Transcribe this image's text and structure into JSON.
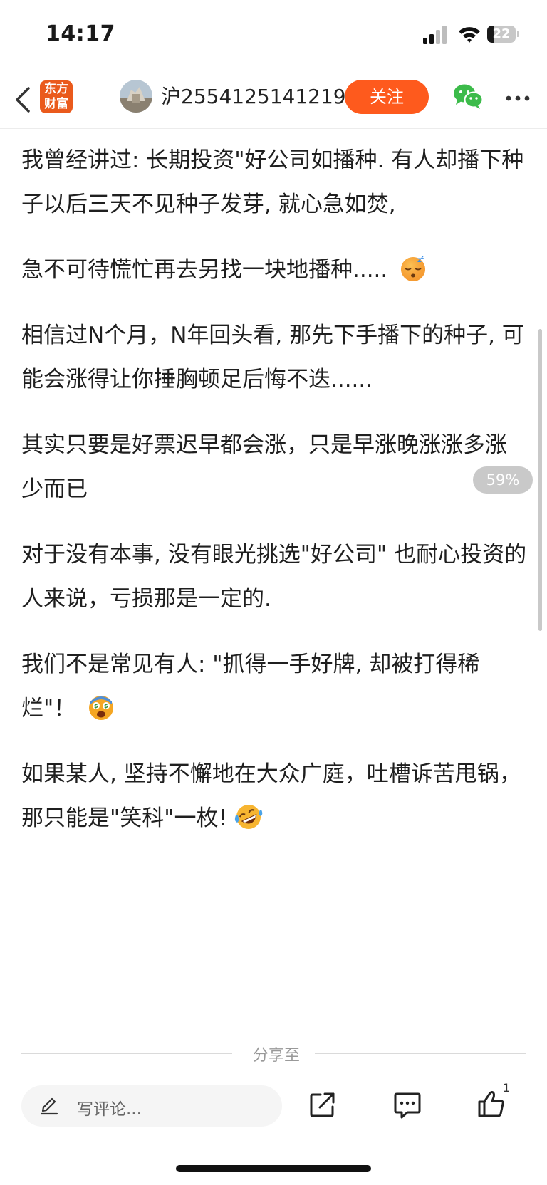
{
  "status_bar": {
    "time": "14:17",
    "battery_level": "22"
  },
  "nav": {
    "logo_line1": "东方",
    "logo_line2": "财富",
    "username": "沪2554125141219",
    "follow_label": "关注"
  },
  "article": {
    "paragraphs": [
      "我曾经讲过: 长期投资\"好公司如播种. 有人却播下种子以后三天不见种子发芽, 就心急如焚,",
      "急不可待慌忙再去另找一块地播种.....",
      "相信过N个月，N年回头看, 那先下手播下的种子, 可能会涨得让你捶胸顿足后悔不迭......",
      "其实只要是好票迟早都会涨，只是早涨晚涨涨多涨少而已",
      "对于没有本事, 没有眼光挑选\"好公司\"  也耐心投资的人来说，亏损那是一定的.",
      "我们不是常见有人: \"抓得一手好牌, 却被打得稀烂\"！",
      "如果某人, 坚持不懈地在大众广庭，吐槽诉苦甩锅，那只能是\"笑科\"一枚!"
    ],
    "emojis": [
      "sleepy-face",
      "money-mouth-shocked-face",
      "rolling-laughing-face"
    ]
  },
  "scroll_percent": "59%",
  "share_label": "分享至",
  "bottom_bar": {
    "comment_placeholder": "写评论...",
    "like_count": "1"
  },
  "colors": {
    "accent": "#fe5a1d",
    "logo": "#ea5a1c",
    "wechat": "#3cbb4a"
  }
}
